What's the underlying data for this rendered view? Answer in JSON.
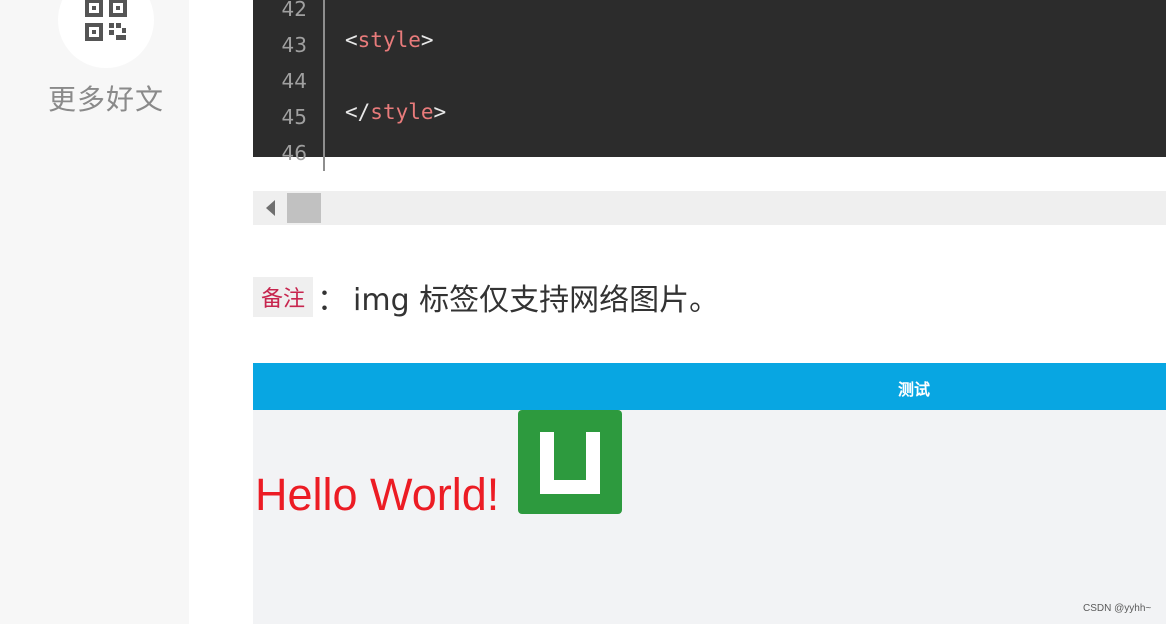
{
  "sidebar": {
    "icon": "qr-code-icon",
    "label": "更多好文"
  },
  "code": {
    "lines": [
      {
        "no": "42",
        "text": ""
      },
      {
        "no": "43",
        "open": "<",
        "tag": "style",
        "close": ">"
      },
      {
        "no": "44",
        "text": ""
      },
      {
        "no": "45",
        "open": "</",
        "tag": "style",
        "close": ">"
      },
      {
        "no": "46",
        "text": ""
      }
    ]
  },
  "scrollbar": {
    "left_arrow_icon": "triangle-left-icon"
  },
  "note": {
    "tag": "备注",
    "separator": "：",
    "text": "img 标签仅支持网络图片。"
  },
  "preview": {
    "nav_title": "测试",
    "hello_text": "Hello World!",
    "logo_icon": "uniapp-logo-icon",
    "nav_color": "#08a6e2",
    "logo_color": "#2d9a3e"
  },
  "watermark": "CSDN @yyhh~"
}
